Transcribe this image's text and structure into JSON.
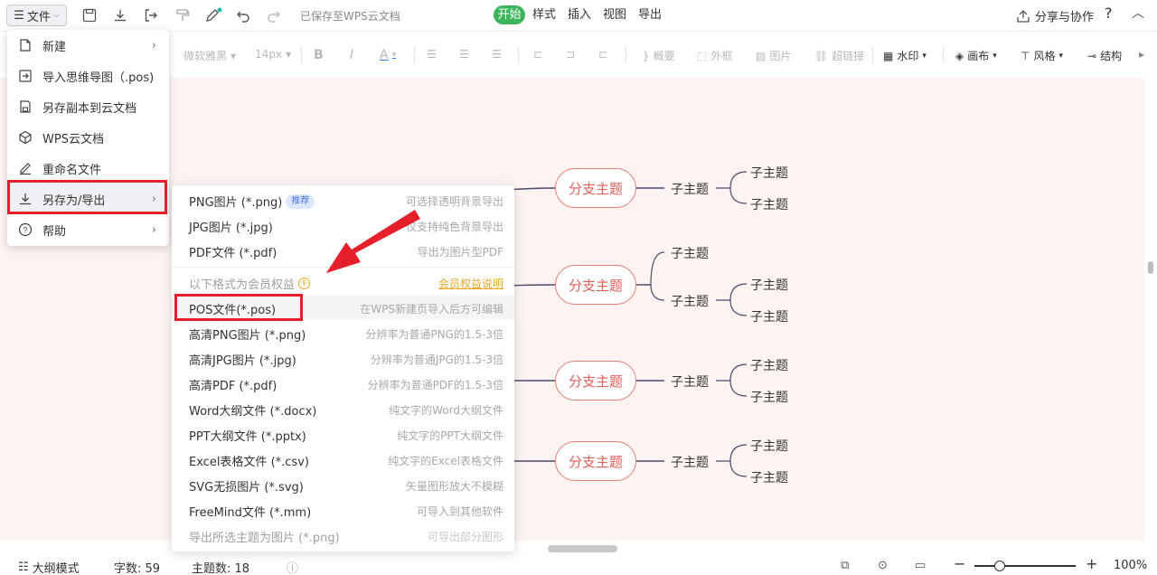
{
  "topbar": {
    "file_label": "文件",
    "saved_status": "已保存至WPS云文档",
    "tabs": [
      "开始",
      "样式",
      "插入",
      "视图",
      "导出"
    ],
    "share_label": "分享与协作",
    "help_label": "?"
  },
  "format_toolbar": {
    "font": "微软雅黑",
    "size": "14px",
    "bold": "B",
    "italic": "I",
    "fontcolor": "A",
    "summary": "概要",
    "outer_frame": "外框",
    "image": "图片",
    "hyperlink": "超链接",
    "watermark": "水印",
    "canvas": "画布",
    "style": "风格",
    "structure": "结构"
  },
  "file_menu": {
    "items": [
      {
        "label": "新建",
        "icon": "new-file-icon",
        "has_submenu": true
      },
      {
        "label": "导入思维导图（.pos)",
        "icon": "import-icon",
        "has_submenu": false
      },
      {
        "label": "另存副本到云文档",
        "icon": "cloud-copy-icon",
        "has_submenu": false
      },
      {
        "label": "WPS云文档",
        "icon": "cube-icon",
        "has_submenu": false
      },
      {
        "label": "重命名文件",
        "icon": "pencil-icon",
        "has_submenu": false
      },
      {
        "label": "另存为/导出",
        "icon": "download-icon",
        "has_submenu": true
      },
      {
        "label": "帮助",
        "icon": "help-icon",
        "has_submenu": true
      }
    ]
  },
  "export_menu": {
    "items": [
      {
        "label": "PNG图片 (*.png)",
        "badge": "推荐",
        "hint": "可选择透明背景导出"
      },
      {
        "label": "JPG图片 (*.jpg)",
        "hint": "仅支持纯色背景导出"
      },
      {
        "label": "PDF文件 (*.pdf)",
        "hint": "导出为图片型PDF"
      },
      {
        "label": "以下格式为会员权益",
        "hint": "会员权益说明"
      },
      {
        "label": "POS文件(*.pos)",
        "hint": "在WPS新建页导入后方可编辑"
      },
      {
        "label": "高清PNG图片 (*.png)",
        "hint": "分辨率为普通PNG的1.5-3倍"
      },
      {
        "label": "高清JPG图片 (*.jpg)",
        "hint": "分辨率为普通JPG的1.5-3倍"
      },
      {
        "label": "高清PDF (*.pdf)",
        "hint": "分辨率为普通PDF的1.5-3倍"
      },
      {
        "label": "Word大纲文件 (*.docx)",
        "hint": "纯文字的Word大纲文件"
      },
      {
        "label": "PPT大纲文件 (*.pptx)",
        "hint": "纯文字的PPT大纲文件"
      },
      {
        "label": "Excel表格文件 (*.csv)",
        "hint": "纯文字的Excel表格文件"
      },
      {
        "label": "SVG无损图片 (*.svg)",
        "hint": "矢量图形放大不模糊"
      },
      {
        "label": "FreeMind文件 (*.mm)",
        "hint": "可导入到其他软件"
      },
      {
        "label": "导出所选主题为图片 (*.png)",
        "hint": "可导出部分图形"
      }
    ]
  },
  "mindmap": {
    "branch_label": "分支主题",
    "sub_label": "子主题"
  },
  "statusbar": {
    "outline_mode": "大纲模式",
    "word_count": "字数: 59",
    "topic_count": "主题数: 18",
    "zoom": "100%"
  },
  "colors": {
    "accent_green": "#3bb45c",
    "branch_red": "#e87b72",
    "highlight_red": "#e5202b",
    "canvas_bg": "#fdf4f2"
  }
}
